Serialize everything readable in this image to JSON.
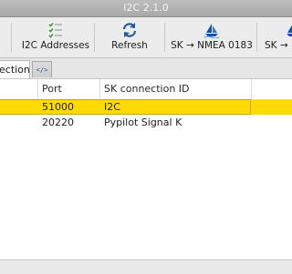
{
  "window": {
    "title": "I2C 2.1.0"
  },
  "toolbar": {
    "items": [
      {
        "label": "I2C Addresses",
        "icon": "list-icon"
      },
      {
        "label": "Refresh",
        "icon": "refresh-icon"
      },
      {
        "label": "SK → NMEA 0183",
        "icon": "sailboat-icon"
      },
      {
        "label": "SK → I",
        "icon": "sailboat-icon"
      }
    ]
  },
  "tabs": [
    {
      "label": "ections",
      "active": true
    },
    {
      "label": "</>",
      "active": false
    }
  ],
  "table": {
    "columns": [
      "",
      "Port",
      "SK connection ID"
    ],
    "rows": [
      {
        "c0": "",
        "port": "51000",
        "id": "I2C",
        "selected": true
      },
      {
        "c0": "",
        "port": "20220",
        "id": "Pypilot Signal K",
        "selected": false
      }
    ]
  },
  "colors": {
    "selection": "#ffda05",
    "titlebar": "#b0b0b0",
    "refresh_icon": "#1e5aa0",
    "list_icon": "#2f9a2f",
    "sail_icon": "#1a4fa8"
  }
}
